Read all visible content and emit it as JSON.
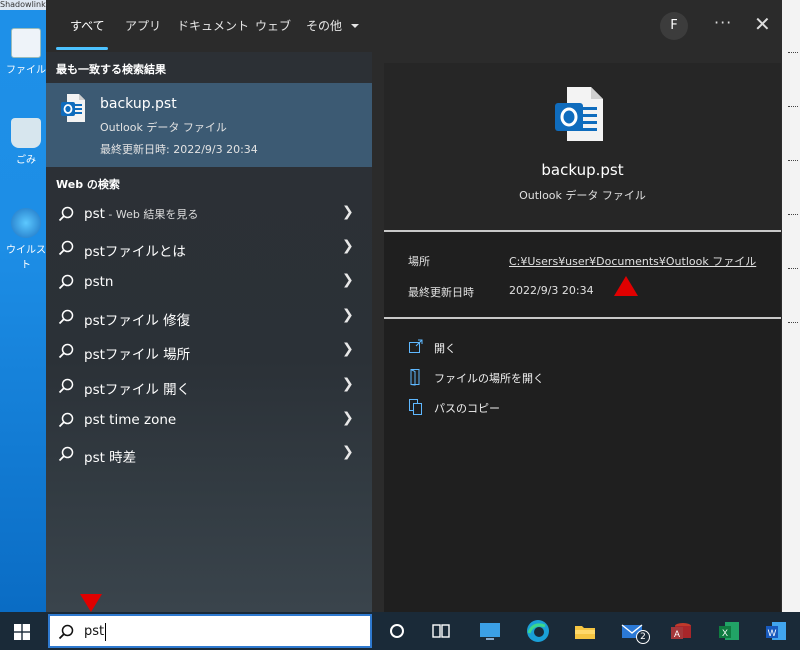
{
  "tabs": [
    {
      "label": "すべて"
    },
    {
      "label": "アプリ"
    },
    {
      "label": "ドキュメント"
    },
    {
      "label": "ウェブ"
    },
    {
      "label": "その他"
    }
  ],
  "header": {
    "avatar_initial": "F",
    "more_label": "···",
    "close_label": "✕"
  },
  "best_match": {
    "section_title": "最も一致する検索結果",
    "name": "backup.pst",
    "type": "Outlook データ ファイル",
    "modified": "最終更新日時: 2022/9/3 20:34"
  },
  "web": {
    "section_title": "Web の検索",
    "items": [
      {
        "label": "pst",
        "suffix": " - Web 結果を見る"
      },
      {
        "label": "pstファイルとは",
        "suffix": ""
      },
      {
        "label": "pstn",
        "suffix": ""
      },
      {
        "label": "pstファイル 修復",
        "suffix": ""
      },
      {
        "label": "pstファイル 場所",
        "suffix": ""
      },
      {
        "label": "pstファイル 開く",
        "suffix": ""
      },
      {
        "label": "pst time zone",
        "suffix": ""
      },
      {
        "label": "pst 時差",
        "suffix": ""
      }
    ]
  },
  "preview": {
    "name": "backup.pst",
    "type": "Outlook データ ファイル",
    "location_label": "場所",
    "location_value": "C:¥Users¥user¥Documents¥Outlook ファイル",
    "modified_label": "最終更新日時",
    "modified_value": "2022/9/3 20:34",
    "actions": [
      {
        "label": "開く",
        "icon": "open-icon"
      },
      {
        "label": "ファイルの場所を開く",
        "icon": "folder-location-icon"
      },
      {
        "label": "パスのコピー",
        "icon": "copy-path-icon"
      }
    ]
  },
  "search": {
    "value": "pst"
  },
  "desktop": {
    "icons": [
      {
        "label": "ファイル"
      },
      {
        "label": "ごみ"
      },
      {
        "label": "ウイルスト"
      }
    ],
    "top_strip": "Shadowlink"
  },
  "taskbar": {
    "mail_badge": "2"
  },
  "colors": {
    "accent": "#4cc2ff",
    "best_match_bg": "#3c5a73",
    "marker": "#e00000",
    "outlook_blue": "#0f6cbd"
  }
}
